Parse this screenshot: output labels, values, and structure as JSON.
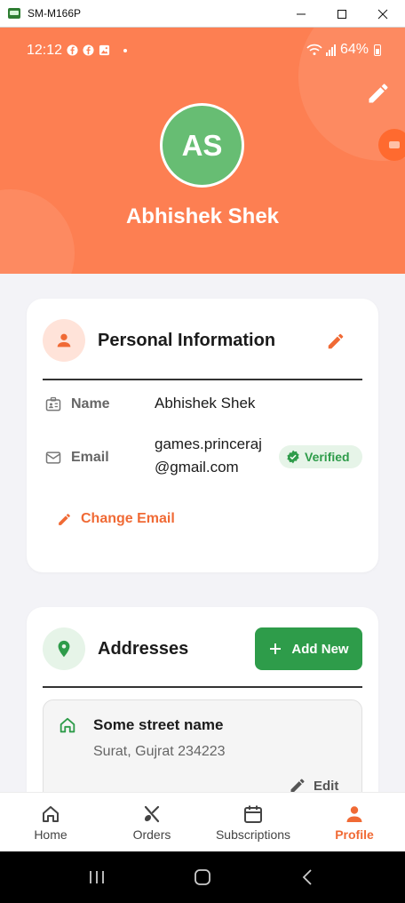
{
  "window": {
    "title": "SM-M166P"
  },
  "status_bar": {
    "time": "12:12",
    "battery": "64%"
  },
  "header": {
    "avatar_initials": "AS",
    "name": "Abhishek Shek"
  },
  "personal_info": {
    "title": "Personal Information",
    "name_label": "Name",
    "name_value": "Abhishek Shek",
    "email_label": "Email",
    "email_line1": "games.princeraj",
    "email_line2": "@gmail.com",
    "verified_label": "Verified",
    "change_email_label": "Change Email"
  },
  "addresses": {
    "title": "Addresses",
    "add_new_label": "Add New",
    "items": [
      {
        "line1": "Some street name",
        "line2": "Surat, Gujrat 234223",
        "edit_label": "Edit"
      }
    ]
  },
  "bottom_nav": {
    "items": [
      {
        "label": "Home",
        "icon": "home-icon"
      },
      {
        "label": "Orders",
        "icon": "utensils-icon"
      },
      {
        "label": "Subscriptions",
        "icon": "calendar-icon"
      },
      {
        "label": "Profile",
        "icon": "person-icon"
      }
    ],
    "active": "Profile"
  },
  "colors": {
    "brand_orange": "#fd7f52",
    "accent_orange": "#f06a35",
    "green": "#2e9c4a",
    "avatar_green": "#67bd73"
  }
}
